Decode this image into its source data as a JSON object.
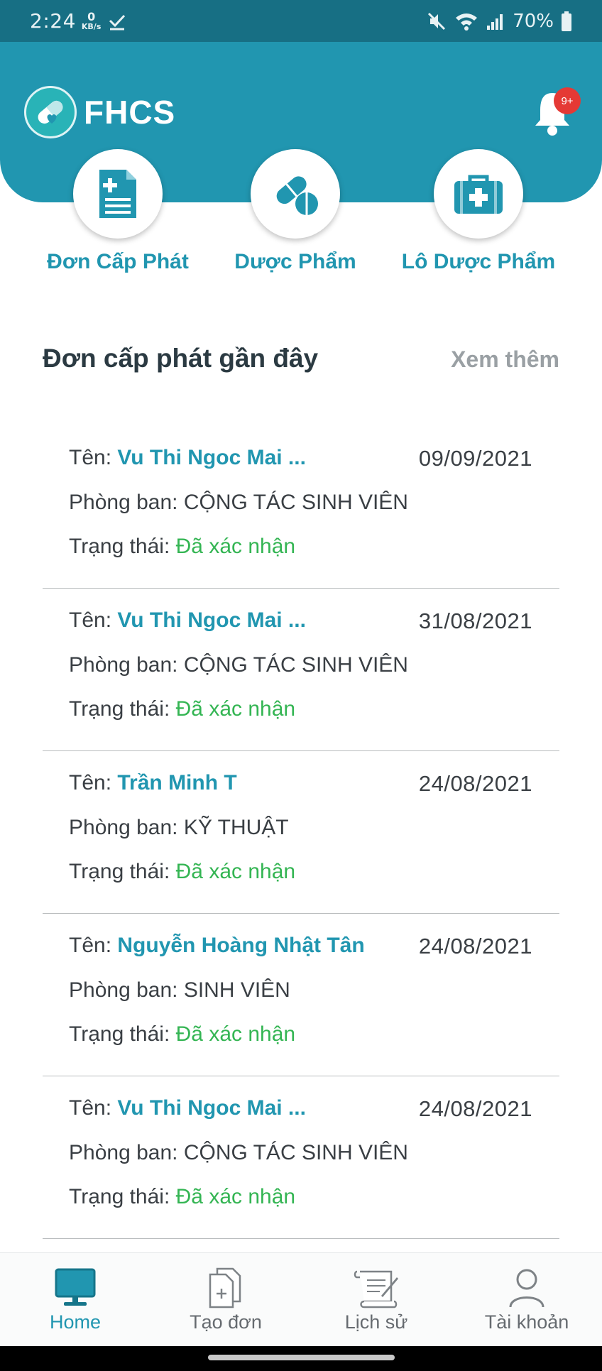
{
  "status_bar": {
    "time": "2:24",
    "net_speed_value": "0",
    "net_speed_unit": "KB/s",
    "battery": "70%"
  },
  "header": {
    "app_title": "FHCS",
    "notification_badge": "9+"
  },
  "quick_actions": [
    {
      "label": "Đơn Cấp Phát",
      "icon": "document-plus-icon"
    },
    {
      "label": "Dược Phẩm",
      "icon": "pill-icon"
    },
    {
      "label": "Lô Dược Phẩm",
      "icon": "medical-kit-icon"
    }
  ],
  "recent": {
    "title": "Đơn cấp phát gần đây",
    "see_more": "Xem thêm",
    "name_label": "Tên: ",
    "dept_label": "Phòng ban: ",
    "status_label": "Trạng thái: ",
    "items": [
      {
        "name": "Vu Thi Ngoc Mai ...",
        "date": "09/09/2021",
        "department": "CỘNG TÁC SINH VIÊN",
        "status": "Đã xác nhận"
      },
      {
        "name": "Vu Thi Ngoc Mai ...",
        "date": "31/08/2021",
        "department": "CỘNG TÁC SINH VIÊN",
        "status": "Đã xác nhận"
      },
      {
        "name": "Trần Minh T",
        "date": "24/08/2021",
        "department": "KỸ THUẬT",
        "status": "Đã xác nhận"
      },
      {
        "name": "Nguyễn Hoàng Nhật Tân",
        "date": "24/08/2021",
        "department": "SINH VIÊN",
        "status": "Đã xác nhận"
      },
      {
        "name": "Vu Thi Ngoc Mai ...",
        "date": "24/08/2021",
        "department": "CỘNG TÁC SINH VIÊN",
        "status": "Đã xác nhận"
      }
    ]
  },
  "bottom_nav": [
    {
      "label": "Home",
      "icon": "monitor-icon",
      "active": true
    },
    {
      "label": "Tạo đơn",
      "icon": "new-document-icon",
      "active": false
    },
    {
      "label": "Lịch sử",
      "icon": "scroll-icon",
      "active": false
    },
    {
      "label": "Tài khoản",
      "icon": "user-icon",
      "active": false
    }
  ],
  "colors": {
    "primary": "#2196b0",
    "status_bar": "#176f84",
    "status_confirmed": "#34b553",
    "badge": "#e53935"
  }
}
